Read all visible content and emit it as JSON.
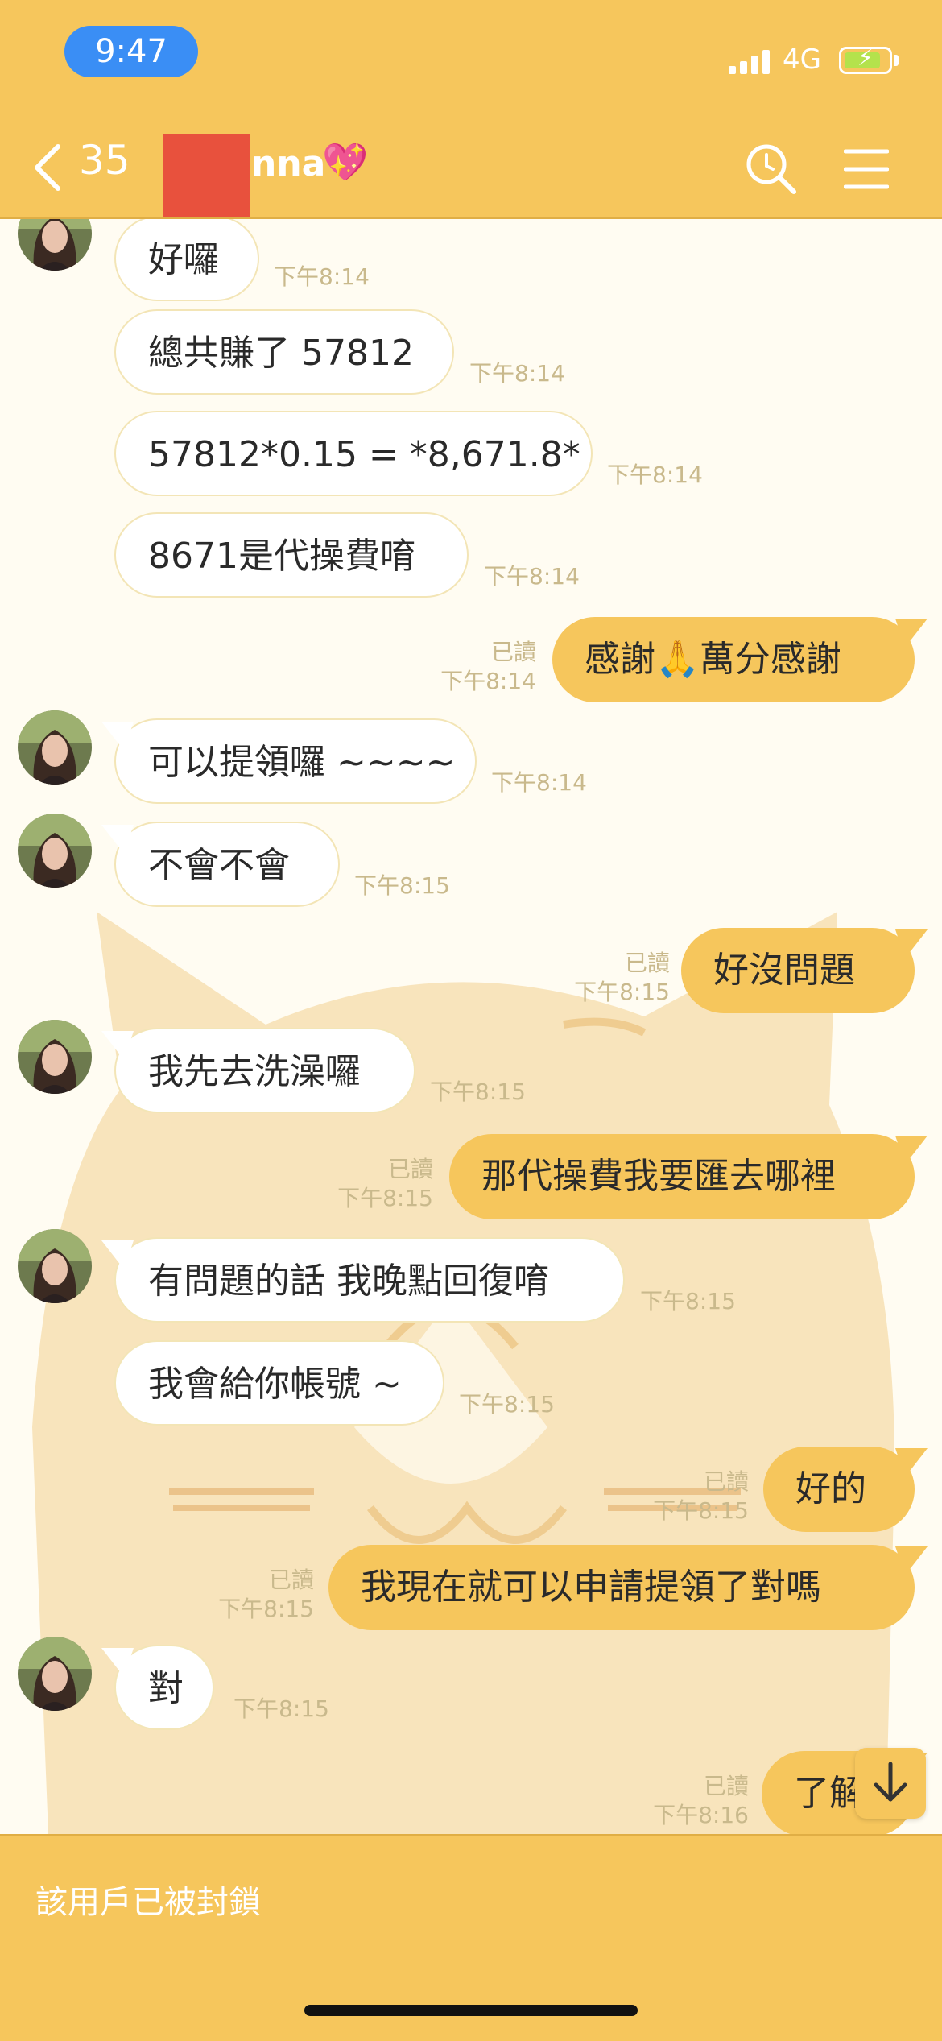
{
  "status_bar": {
    "time": "9:47",
    "network": "4G"
  },
  "header": {
    "back_count": "35",
    "title": "nna",
    "title_emoji": "💖"
  },
  "messages": [
    {
      "side": "in",
      "text": "好囉",
      "time": "下午8:14"
    },
    {
      "side": "in",
      "text": "總共賺了 57812",
      "time": "下午8:14"
    },
    {
      "side": "in",
      "text": "57812*0.15 = *8,671.8*",
      "time": "下午8:14"
    },
    {
      "side": "in",
      "text": "8671是代操費唷",
      "time": "下午8:14"
    },
    {
      "side": "out",
      "text": "感謝🙏萬分感謝",
      "time": "下午8:14",
      "read": "已讀"
    },
    {
      "side": "in",
      "text": "可以提領囉 ~~~~",
      "time": "下午8:14"
    },
    {
      "side": "in",
      "text": "不會不會",
      "time": "下午8:15"
    },
    {
      "side": "out",
      "text": "好沒問題",
      "time": "下午8:15",
      "read": "已讀"
    },
    {
      "side": "in",
      "text": "我先去洗澡囉",
      "time": "下午8:15"
    },
    {
      "side": "out",
      "text": "那代操費我要匯去哪裡",
      "time": "下午8:15",
      "read": "已讀"
    },
    {
      "side": "in",
      "text": "有問題的話 我晚點回復唷",
      "time": "下午8:15"
    },
    {
      "side": "in",
      "text": "我會給你帳號 ~",
      "time": "下午8:15"
    },
    {
      "side": "out",
      "text": "好的",
      "time": "下午8:15",
      "read": "已讀"
    },
    {
      "side": "out",
      "text": "我現在就可以申請提領了對嗎",
      "time": "下午8:15",
      "read": "已讀"
    },
    {
      "side": "in",
      "text": "對",
      "time": "下午8:15"
    },
    {
      "side": "out",
      "text": "了解",
      "time": "下午8:16",
      "read": "已讀"
    }
  ],
  "footer": {
    "blocked_text": "該用戶已被封鎖"
  },
  "colors": {
    "accent": "#f6c65c",
    "chat_bg": "#fffcf2",
    "time_pill": "#3a8ef5"
  },
  "icons": [
    "back-chevron-icon",
    "search-icon",
    "menu-icon",
    "scroll-down-icon",
    "battery-icon",
    "signal-icon"
  ]
}
